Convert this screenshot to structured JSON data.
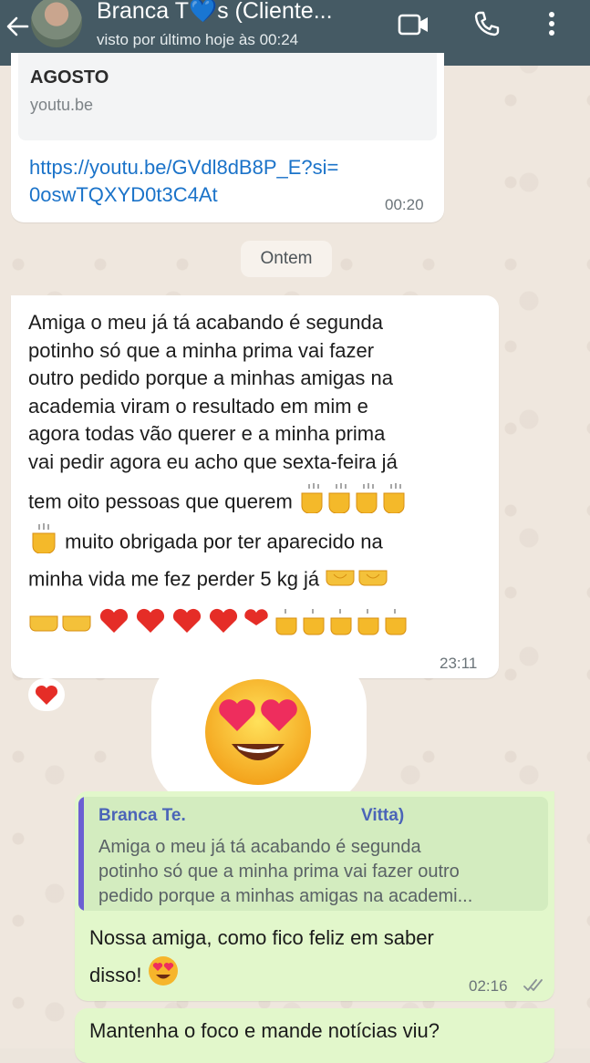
{
  "header": {
    "contact_name": "Branca T💙s (Cliente...",
    "status": "visto por último hoje às 00:24",
    "icons": [
      "back-arrow-icon",
      "avatar",
      "video-call-icon",
      "phone-icon",
      "more-vert-icon"
    ],
    "background": "#455a64"
  },
  "link_message": {
    "preview_title": "AGOSTO",
    "preview_domain": "youtu.be",
    "url_line1": "https://youtu.be/GVdl8dB8P_E?si=",
    "url_line2": "0oswTQXYD0t3C4At",
    "time": "00:20"
  },
  "date_separator": "Ontem",
  "incoming_message": {
    "lines": [
      "Amiga o meu já tá acabando é segunda",
      "potinho só que a minha prima vai fazer",
      "outro pedido porque a minhas amigas na",
      "academia viram o resultado em mim e",
      "agora todas vão querer e a minha prima",
      "vai pedir agora eu acho que sexta-feira já",
      "tem oito pessoas que querem",
      "muito obrigada por ter aparecido na",
      "minha vida me fez perder 5 kg já"
    ],
    "time": "23:11",
    "reaction": "❤️"
  },
  "sticker_emoji": "smiling-face-with-heart-eyes",
  "reply_message": {
    "quoted_author_start": "Branca Te.",
    "quoted_author_end": "Vitta)",
    "quoted_lines": [
      "Amiga o meu já tá acabando é segunda",
      "potinho só que a minha prima vai fazer outro",
      "pedido porque a minhas amigas na academi..."
    ],
    "text_line1": "Nossa amiga, como fico feliz em saber",
    "text_line2": "disso!",
    "time": "02:16",
    "status_icon": "double-check-icon"
  },
  "last_message": {
    "text": "Mantenha o foco e mande notícias viu?"
  },
  "colors": {
    "incoming_bubble": "#ffffff",
    "outgoing_bubble": "#e2f7cb",
    "link": "#1b73c9",
    "quote_bar": "#6b5fd3",
    "quote_author": "#4b64b8"
  }
}
